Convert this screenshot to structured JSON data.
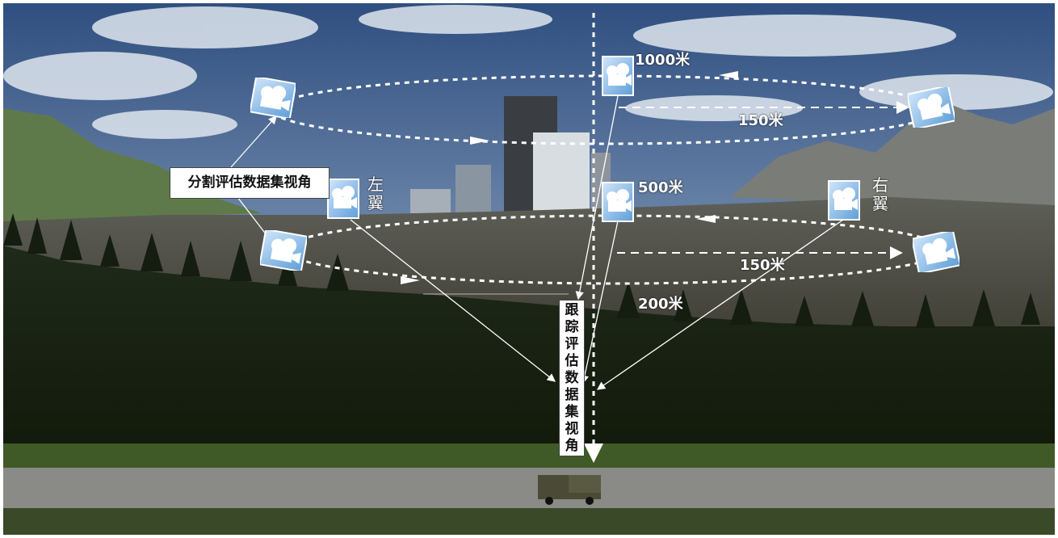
{
  "labels": {
    "alt_1000": "1000米",
    "alt_500": "500米",
    "alt_200": "200米",
    "radius_upper": "150米",
    "radius_lower": "150米",
    "left_wing": "左翼",
    "right_wing": "右翼",
    "segmentation_view": "分割评估数据集视角",
    "tracking_view": "跟踪评估数据集视角"
  },
  "icons": {
    "camera": "camera-icon",
    "vehicle": "truck-icon"
  },
  "colors": {
    "sky_top": "#3d5f8f",
    "sky_bottom": "#b9c8d8",
    "mountain": "#6b7068",
    "trees": "#1b2416",
    "road": "#8a8a86",
    "camera_tile": "#7fb3e0",
    "annotation": "#ffffff"
  }
}
